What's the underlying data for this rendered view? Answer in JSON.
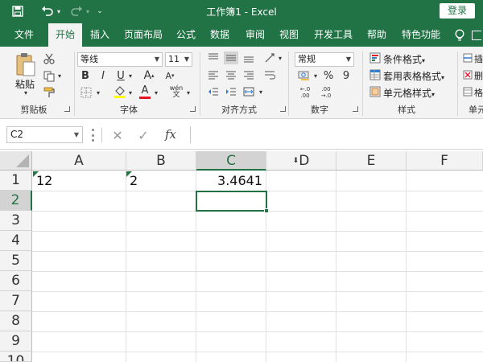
{
  "window": {
    "title": "工作簿1 - Excel",
    "login_label": "登录"
  },
  "tabs": [
    {
      "label": "文件",
      "active": false
    },
    {
      "label": "开始",
      "active": true
    },
    {
      "label": "插入",
      "active": false
    },
    {
      "label": "页面布局",
      "active": false
    },
    {
      "label": "公式",
      "active": false
    },
    {
      "label": "数据",
      "active": false
    },
    {
      "label": "审阅",
      "active": false
    },
    {
      "label": "视图",
      "active": false
    },
    {
      "label": "开发工具",
      "active": false
    },
    {
      "label": "帮助",
      "active": false
    },
    {
      "label": "特色功能",
      "active": false
    }
  ],
  "ribbon": {
    "clipboard": {
      "group_label": "剪贴板",
      "paste_label": "粘贴"
    },
    "font": {
      "group_label": "字体",
      "font_name": "等线",
      "font_size": "11",
      "bold": "B",
      "italic": "I",
      "underline": "U",
      "grow": "A",
      "shrink": "A",
      "font_color_letter": "A",
      "phonetic": "wén"
    },
    "alignment": {
      "group_label": "对齐方式"
    },
    "number": {
      "group_label": "数字",
      "format": "常规",
      "percent": "%",
      "comma": "9"
    },
    "styles": {
      "group_label": "样式",
      "conditional_format": "条件格式",
      "table_format": "套用表格格式",
      "cell_styles": "单元格样式"
    },
    "cells": {
      "group_label": "单元",
      "insert_label": "插",
      "delete_label": "删",
      "format_label": "格"
    }
  },
  "formula_bar": {
    "name_box": "C2",
    "fx_label": "fx",
    "formula": ""
  },
  "sheet": {
    "columns": [
      "A",
      "B",
      "C",
      "D",
      "E",
      "F"
    ],
    "rows": [
      "1",
      "2",
      "3",
      "4",
      "5",
      "6",
      "7",
      "8",
      "9",
      "10"
    ],
    "cells": {
      "A1": "12",
      "B1": "2",
      "C1": "3.4641"
    },
    "active_cell": "C2"
  },
  "colors": {
    "accent": "#217346",
    "error_triangle": "#1e7a3c"
  }
}
